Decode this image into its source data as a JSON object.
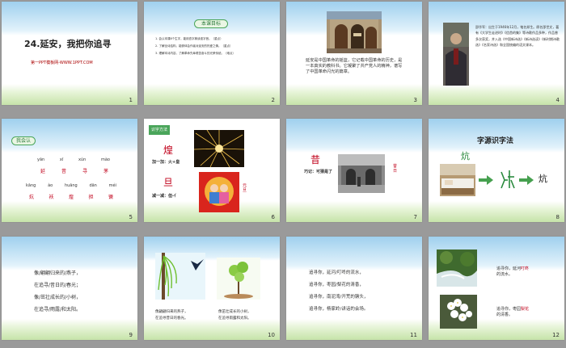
{
  "slides": [
    {
      "num": "1",
      "title": "24.延安，我把你追寻",
      "sub": "第一PPT模板网-WWW.1PPT.COM"
    },
    {
      "num": "2",
      "badge": "本课目标",
      "goals": [
        "1. 会认本课8个生字，能用查字典读准字音。（重点）",
        "2. 了解全诗结构，能够体会作者对延安的热爱之情。（重点）",
        "3. 理解本诗内容，了解革命先辈艰苦奋斗的光荣传统。（难点）"
      ]
    },
    {
      "num": "3",
      "caption": "延安是中国革命的摇篮，它记载中国革命的历史，是一本真实的教科书。它凝聚了共产党人的精神，谱写了中国革命闪光的篇章。"
    },
    {
      "num": "4",
      "bio": "邵华军：出生于1946年12月，笔名邦生。原名邵世文，著有《大学生走进时》《信首的集》等诗歌作品多种，作品曾多次获奖，并入选《中国新诗选》《新诗选读》《新时期诗歌选》《名家诗选》和全国统编的语文课本。",
      "bio_name": "邵华军"
    },
    {
      "num": "5",
      "badge": "我会认",
      "pinyin1": [
        "yān",
        "xī",
        "xún",
        "mào"
      ],
      "chars1": [
        "延",
        "昔",
        "寻",
        "茅"
      ],
      "pinyin2": [
        "kāng",
        "ào",
        "huāng",
        "dān",
        "méi"
      ],
      "chars2": [
        "炕",
        "袄",
        "煌",
        "担",
        "镢"
      ]
    },
    {
      "num": "6",
      "badge": "识字方法",
      "char1": "煌",
      "rule1": "加一加：火+皇",
      "char2": "旦",
      "rule2": "减一减：但-亻",
      "poster_text": "元旦"
    },
    {
      "num": "7",
      "char": "昔",
      "rule": "巧记：可猜是了",
      "side": "昔日"
    },
    {
      "num": "8",
      "title": "字源识字法",
      "char": "炕",
      "char_end": "炕"
    },
    {
      "num": "9",
      "lines": [
        "像/翩翩归来的/燕子，",
        "在追寻/昔日的/春光；",
        "像/茁壮成长的/小树，",
        "在追寻/雨露/和太阳。"
      ]
    },
    {
      "num": "10",
      "cap_left": [
        "像翩翩归来的燕子，",
        "在追寻昔日的春光。"
      ],
      "cap_right": [
        "像茁壮成长的小树，",
        "在追寻雨露和太阳。"
      ]
    },
    {
      "num": "11",
      "lines": [
        "追寻你，延河/叮咚的流水，",
        "追寻你，枣园/梨花的清香，",
        "追寻你，南泥湾/开荒的镢头，",
        "追寻你，杨家岭/讲话的会场。"
      ]
    },
    {
      "num": "12",
      "line1a": "追寻你，",
      "line1b": "延河",
      "line1c": "叮咚",
      "line1d": "的流水。",
      "line2a": "追寻你，",
      "line2b": "枣园",
      "line2c": "梨花",
      "line2d": "的清香。"
    }
  ],
  "colors": {
    "accent": "#c0001a",
    "green": "#4aa55a"
  }
}
